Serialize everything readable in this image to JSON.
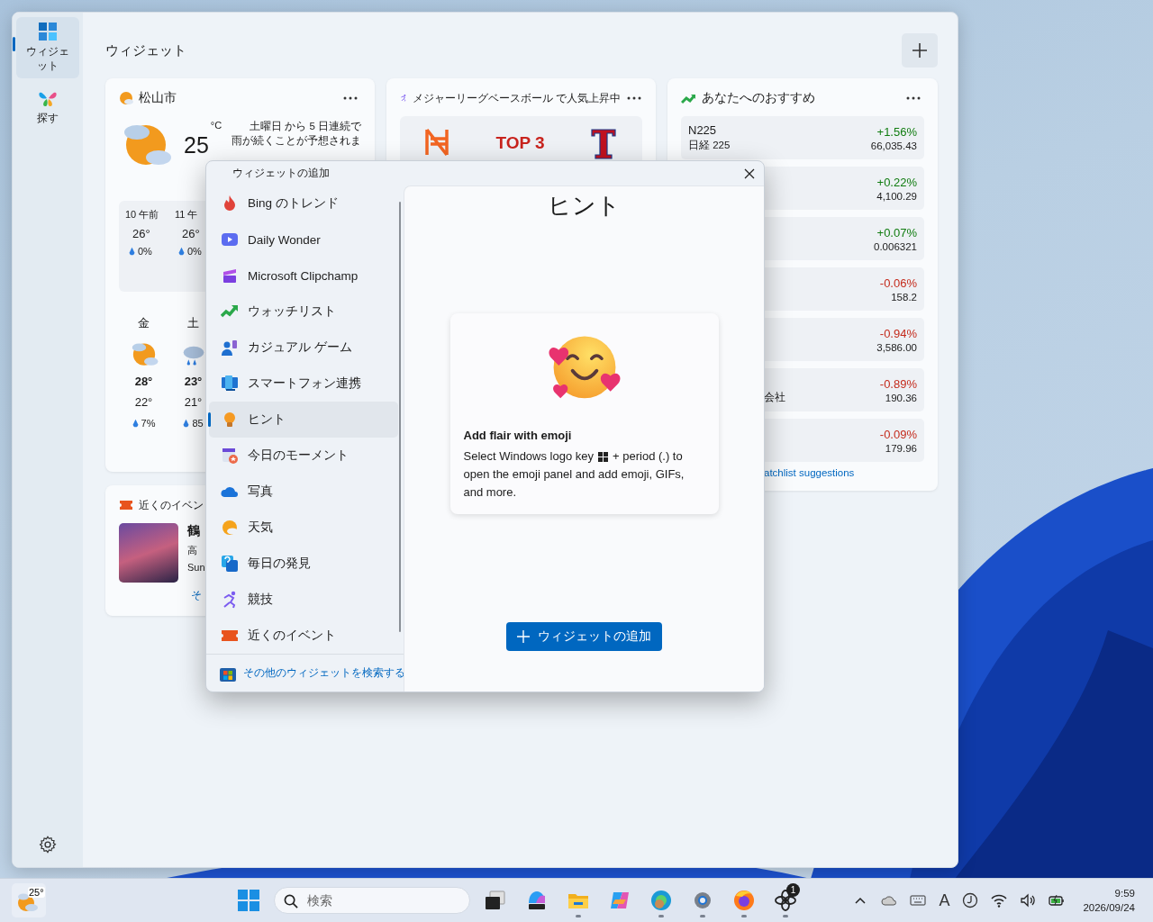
{
  "sidebar": {
    "items": [
      {
        "label": "ウィジェット",
        "kind": "widgets",
        "selected": true
      },
      {
        "label": "探す",
        "kind": "discover",
        "selected": false
      }
    ]
  },
  "header": {
    "title": "ウィジェット"
  },
  "weather": {
    "location": "松山市",
    "temperature": "25",
    "unit": "°C",
    "summary": [
      "土曜日 から 5 日連続で",
      "雨が続くことが予想されま"
    ],
    "hourly": [
      {
        "time": "10 午前",
        "temp": "26°",
        "precip": "0%"
      },
      {
        "time": "11 午",
        "temp": "26°",
        "precip": "0%"
      }
    ],
    "daily": [
      {
        "day": "金",
        "kind": "partly-cloudy",
        "high": "28°",
        "low": "22°",
        "precip": "7%"
      },
      {
        "day": "土",
        "kind": "rain",
        "high": "23°",
        "low": "21°",
        "precip": "85"
      }
    ]
  },
  "events": {
    "title": "近くのイベン",
    "name": "鶴",
    "place": "高",
    "date": "Sun",
    "link": "そ"
  },
  "sports": {
    "title": "メジャーリーグベースボール で人気上昇中",
    "headline": "TOP 3"
  },
  "stocks": {
    "title": "あなたへのおすすめ",
    "rows": [
      {
        "name": "N225",
        "subtitle": "日経 225",
        "change": "+1.56%",
        "price": "66,035.43",
        "color": "#107c10"
      },
      {
        "change": "+0.22%",
        "price": "4,100.29",
        "color": "#107c10"
      },
      {
        "change": "+0.07%",
        "price": "0.006321",
        "color": "#107c10"
      },
      {
        "change": "-0.06%",
        "price": "158.2",
        "color": "#c42b1c"
      },
      {
        "change": "-0.94%",
        "price": "3,586.00",
        "color": "#c42b1c"
      },
      {
        "subtitle": "会社",
        "change": "-0.89%",
        "price": "190.36",
        "color": "#c42b1c"
      },
      {
        "change": "-0.09%",
        "price": "179.96",
        "color": "#c42b1c"
      }
    ],
    "link": "atchlist suggestions"
  },
  "dialog": {
    "title": "ウィジェットの追加",
    "items": [
      {
        "label": "Bing のトレンド",
        "kind": "flame",
        "selected": false
      },
      {
        "label": "Daily Wonder",
        "kind": "video",
        "selected": false
      },
      {
        "label": "Microsoft Clipchamp",
        "kind": "clip",
        "selected": false
      },
      {
        "label": "ウォッチリスト",
        "kind": "trend",
        "selected": false
      },
      {
        "label": "カジュアル ゲーム",
        "kind": "games",
        "selected": false
      },
      {
        "label": "スマートフォン連携",
        "kind": "phone",
        "selected": false
      },
      {
        "label": "ヒント",
        "kind": "bulb",
        "selected": true
      },
      {
        "label": "今日のモーメント",
        "kind": "moments",
        "selected": false
      },
      {
        "label": "写真",
        "kind": "cloud",
        "selected": false
      },
      {
        "label": "天気",
        "kind": "weather",
        "selected": false
      },
      {
        "label": "毎日の発見",
        "kind": "question",
        "selected": false
      },
      {
        "label": "競技",
        "kind": "runner",
        "selected": false
      },
      {
        "label": "近くのイベント",
        "kind": "ticket",
        "selected": false
      }
    ],
    "footer_link": "その他のウィジェットを検索する",
    "hint": {
      "heading": "ヒント",
      "title": "Add flair with emoji",
      "body_before": "Select Windows logo key",
      "body_middle": "+ period (.) to",
      "body_after": "open the emoji panel and add emoji, GIFs, and more."
    },
    "add_button": "ウィジェットの追加"
  },
  "taskbar": {
    "weather_temp": "25°",
    "search_placeholder": "検索",
    "apps": [
      {
        "kind": "task-view",
        "running": false
      },
      {
        "kind": "m365",
        "running": false
      },
      {
        "kind": "folder",
        "running": true
      },
      {
        "kind": "copilot",
        "running": false
      },
      {
        "kind": "browser",
        "running": true
      },
      {
        "kind": "settings",
        "running": true
      },
      {
        "kind": "fox",
        "running": true
      },
      {
        "kind": "knot",
        "running": true,
        "badge": "1"
      }
    ],
    "ime": "A",
    "time": "9:59",
    "date": "2026/09/24"
  }
}
